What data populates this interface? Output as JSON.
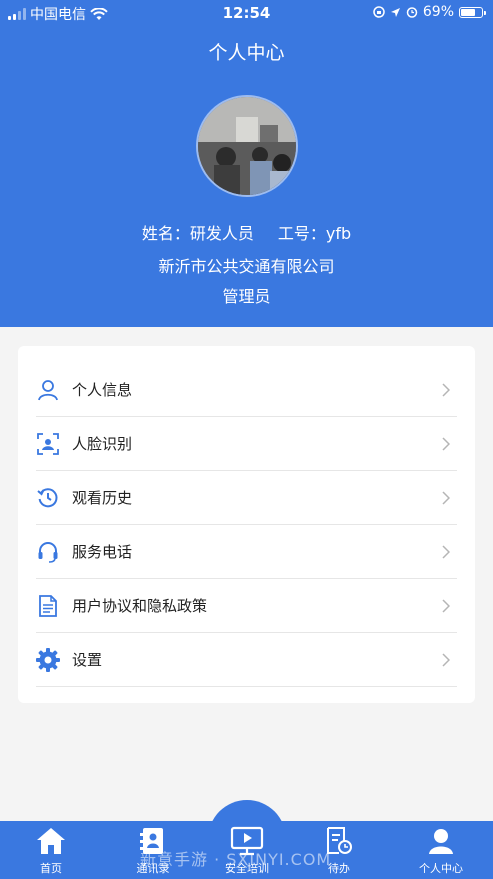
{
  "status_bar": {
    "carrier": "中国电信",
    "time": "12:54",
    "battery": "69%"
  },
  "header": {
    "title": "个人中心",
    "name_label": "姓名：研发人员",
    "id_label": "工号：yfb",
    "company": "新沂市公共交通有限公司",
    "role": "管理员"
  },
  "menu": {
    "items": [
      {
        "label": "个人信息",
        "icon": "user-icon"
      },
      {
        "label": "人脸识别",
        "icon": "face-scan-icon"
      },
      {
        "label": "观看历史",
        "icon": "history-icon"
      },
      {
        "label": "服务电话",
        "icon": "headset-icon"
      },
      {
        "label": "用户协议和隐私政策",
        "icon": "document-icon"
      },
      {
        "label": "设置",
        "icon": "gear-icon"
      }
    ]
  },
  "tabbar": {
    "tabs": [
      {
        "label": "首页",
        "icon": "home-icon"
      },
      {
        "label": "通讯录",
        "icon": "contacts-icon"
      },
      {
        "label": "安全培训",
        "icon": "video-training-icon"
      },
      {
        "label": "待办",
        "icon": "todo-icon"
      },
      {
        "label": "个人中心",
        "icon": "profile-icon"
      }
    ],
    "watermark": "新意手游 · SXINYI.COM"
  },
  "colors": {
    "primary": "#3a78e0",
    "background": "#f4f4f4",
    "icon": "#3a78e0"
  }
}
